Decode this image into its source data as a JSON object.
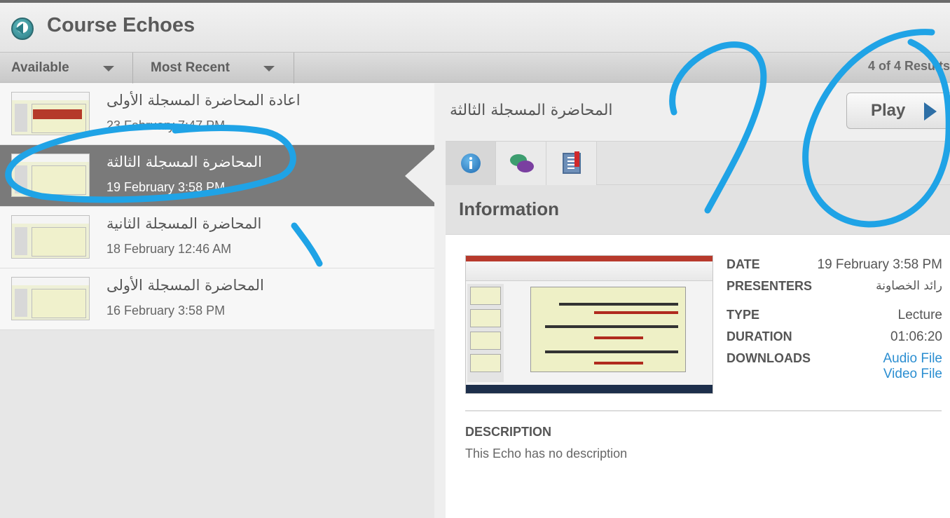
{
  "header": {
    "title": "Course Echoes"
  },
  "filters": {
    "availability": "Available",
    "sort": "Most Recent",
    "results": "4 of 4 Results"
  },
  "echoes": [
    {
      "title": "اعادة المحاضرة المسجلة الأولى",
      "date": "23 February 7:47 PM"
    },
    {
      "title": "المحاضرة المسجلة الثالثة",
      "date": "19 February 3:58 PM"
    },
    {
      "title": "المحاضرة المسجلة الثانية",
      "date": "18 February 12:46 AM"
    },
    {
      "title": "المحاضرة المسجلة الأولى",
      "date": "16 February 3:58 PM"
    }
  ],
  "detail": {
    "title": "المحاضرة المسجلة الثالثة",
    "play_label": "Play",
    "section_heading": "Information",
    "date_label": "DATE",
    "date": "19 February 3:58 PM",
    "presenters_label": "PRESENTERS",
    "presenters": "رائد الخصاونة",
    "type_label": "TYPE",
    "type": "Lecture",
    "duration_label": "DURATION",
    "duration": "01:06:20",
    "downloads_label": "DOWNLOADS",
    "downloads": [
      "Audio File",
      "Video File"
    ],
    "description_label": "DESCRIPTION",
    "description": "This Echo has no description"
  },
  "tabs": [
    "info-icon",
    "discussion-icon",
    "bookmarks-icon"
  ],
  "colors": {
    "selected_row": "#7a7a7a",
    "link": "#2b8ed1",
    "ink": "#1fa3e6",
    "play_arrow": "#2e6fa6"
  }
}
